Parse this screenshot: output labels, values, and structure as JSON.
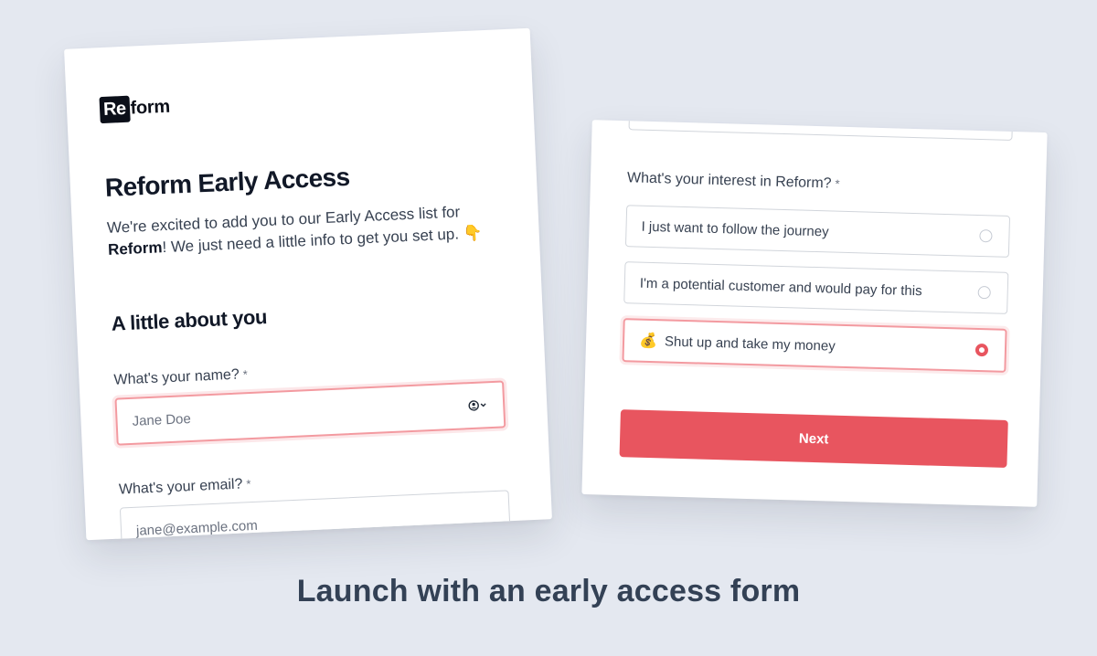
{
  "left_card": {
    "logo_mark": "Re",
    "logo_rest": "form",
    "title": "Reform Early Access",
    "intro_part1": "We're excited to add you to our Early Access list for ",
    "intro_bold": "Reform",
    "intro_part2": "! We just need a little info to get you set up. ",
    "intro_emoji": "👇",
    "section_title": "A little about you",
    "name_label": "What's your name?",
    "name_required": "*",
    "name_placeholder": "Jane Doe",
    "email_label": "What's your email?",
    "email_required": "*",
    "email_placeholder": "jane@example.com"
  },
  "right_card": {
    "question_label": "What's your interest in Reform?",
    "question_required": "*",
    "options": [
      {
        "label": "I just want to follow the journey",
        "selected": false
      },
      {
        "label": "I'm a potential customer and would pay for this",
        "selected": false
      },
      {
        "emoji": "💰",
        "label": "Shut up and take my money",
        "selected": true
      }
    ],
    "next_label": "Next"
  },
  "caption": "Launch with an early access form",
  "colors": {
    "accent": "#e8555f",
    "focus_border": "#f39aa0",
    "background": "#e4e8f0",
    "text_dark": "#111827"
  },
  "icons": {
    "autofill": "contact-autofill-icon"
  }
}
